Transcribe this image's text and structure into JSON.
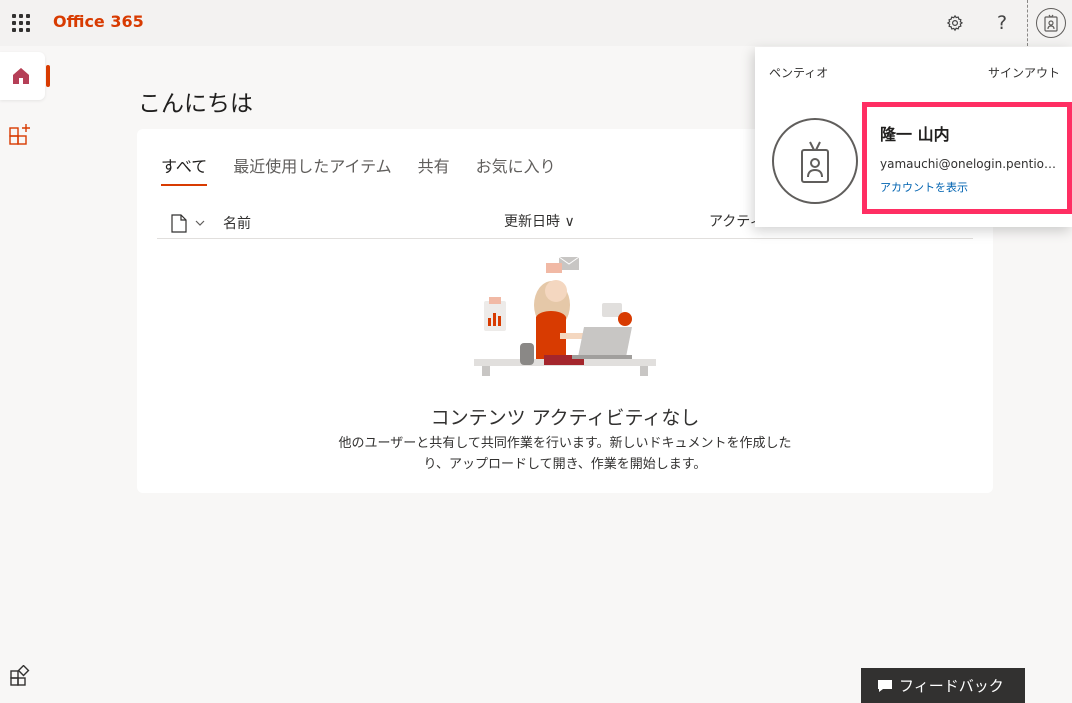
{
  "header": {
    "app_title": "Office 365"
  },
  "greeting": "こんにちは",
  "tabs": [
    {
      "label": "すべて",
      "active": true
    },
    {
      "label": "最近使用したアイテム"
    },
    {
      "label": "共有"
    },
    {
      "label": "お気に入り"
    }
  ],
  "columns": {
    "name": "名前",
    "modified": "更新日時 ∨",
    "activity": "アクティ"
  },
  "empty_state": {
    "title": "コンテンツ アクティビティなし",
    "description": "他のユーザーと共有して共同作業を行います。新しいドキュメントを作成したり、アップロードして開き、作業を開始します。"
  },
  "account": {
    "organization": "ペンティオ",
    "sign_out": "サインアウト",
    "name": "隆一 山内",
    "email": "yamauchi@onelogin.pentio…",
    "view_account": "アカウントを表示"
  },
  "feedback": {
    "label": "フィードバック"
  },
  "colors": {
    "accent": "#d83b01",
    "highlight": "#ff2e63",
    "link": "#0063b1"
  }
}
